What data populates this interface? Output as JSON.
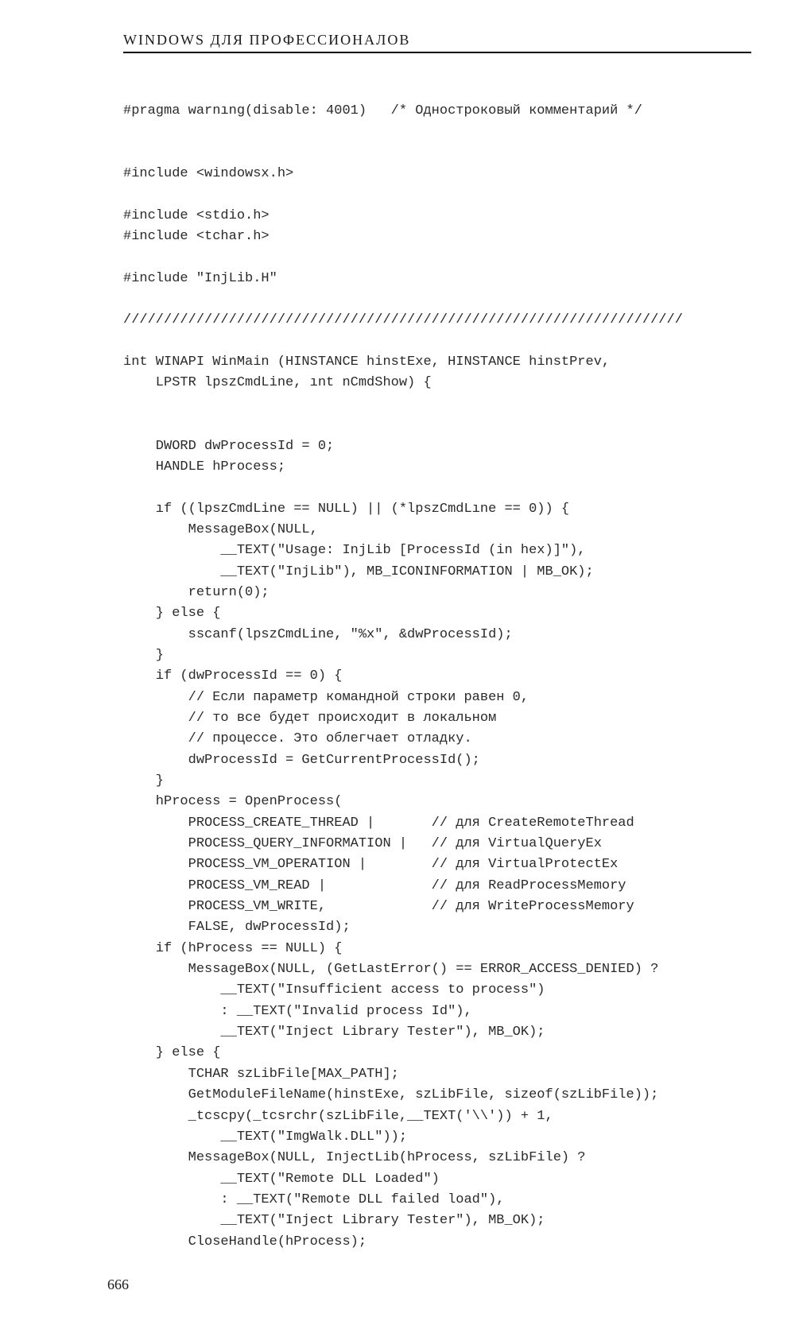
{
  "header": {
    "title": "WINDOWS ДЛЯ ПРОФЕССИОНАЛОВ"
  },
  "code": {
    "lines": [
      "#pragma warnıng(disable: 4001)   /* Однострокoвый комментарий */",
      "",
      "",
      "#include <windowsx.h>",
      "",
      "#include <stdio.h>",
      "#include <tchar.h>",
      "",
      "#include \"InjLib.H\"",
      "",
      "/////////////////////////////////////////////////////////////////////",
      "",
      "int WINAPI WinMain (HINSTANCE hinstExe, HINSTANCE hinstPrev,",
      "    LPSTR lpszCmdLine, ınt nCmdShow) {",
      "",
      "",
      "    DWORD dwProcessId = 0;",
      "    HANDLE hProcess;",
      "",
      "    ıf ((lpszCmdLine == NULL) || (*lpszCmdLıne == 0)) {",
      "        MessageBox(NULL,",
      "            __TEXT(\"Usage: InjLib [ProcessId (in hex)]\"),",
      "            __TEXT(\"InjLib\"), MB_ICONINFORMATION | MB_OK);",
      "        return(0);",
      "    } else {",
      "        sscanf(lpszCmdLine, \"%x\", &dwProcessId);",
      "    }",
      "    if (dwProcessId == 0) {",
      "        // Если параметр командной строки равен 0,",
      "        // то все будет происходит в локальном",
      "        // процессе. Это облегчает отладку.",
      "        dwProcessId = GetCurrentProcessId();",
      "    }",
      "    hProcess = OpenProcess(",
      "        PROCESS_CREATE_THREAD |       // для CreateRemoteThread",
      "        PROCESS_QUERY_INFORMATION |   // для VirtualQueryEx",
      "        PROCESS_VM_OPERATION |        // для VirtualProtectEx",
      "        PROCESS_VM_READ |             // для ReadProcessMemory",
      "        PROCESS_VM_WRITE,             // для WriteProcessMemory",
      "        FALSE, dwProcessId);",
      "    if (hProcess == NULL) {",
      "        MessageBox(NULL, (GetLastError() == ERROR_ACCESS_DENIED) ?",
      "            __TEXT(\"Insufficient access to process\")",
      "            : __TEXT(\"Invalid process Id\"),",
      "            __TEXT(\"Inject Library Tester\"), MB_OK);",
      "    } else {",
      "        TCHAR szLibFile[MAX_PATH];",
      "        GetModuleFileName(hinstExe, szLibFile, sizeof(szLibFile));",
      "        _tcscpy(_tcsrchr(szLibFile,__TEXT('\\\\')) + 1,",
      "            __TEXT(\"ImgWalk.DLL\"));",
      "        MessageBox(NULL, InjectLib(hProcess, szLibFile) ?",
      "            __TEXT(\"Remote DLL Loaded\")",
      "            : __TEXT(\"Remote DLL failed load\"),",
      "            __TEXT(\"Inject Library Tester\"), MB_OK);",
      "        CloseHandle(hProcess);"
    ]
  },
  "footer": {
    "page_number": "666"
  }
}
